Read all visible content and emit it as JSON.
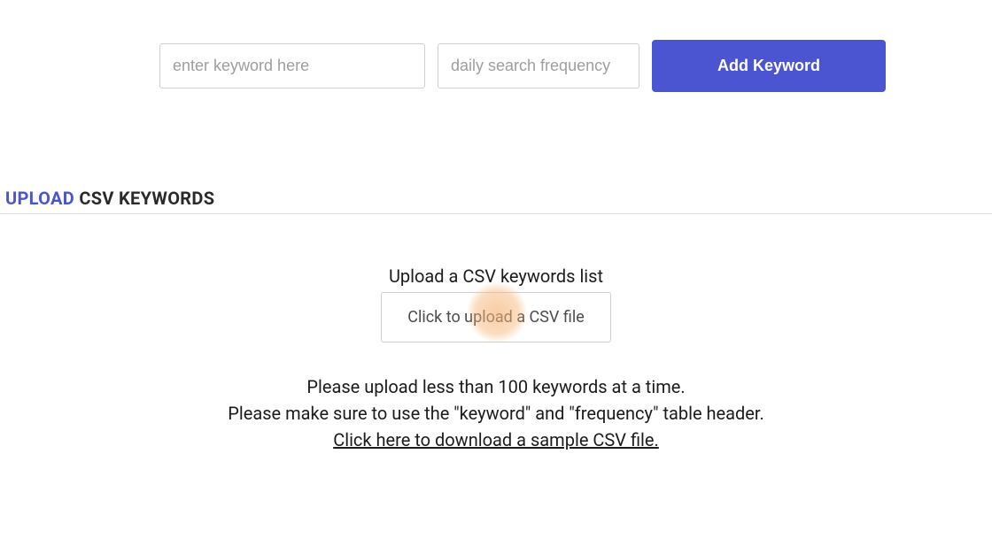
{
  "form": {
    "keyword_placeholder": "enter keyword here",
    "frequency_placeholder": "daily search frequency",
    "add_button_label": "Add Keyword"
  },
  "section": {
    "upload_word": "UPLOAD",
    "rest_heading": " CSV KEYWORDS"
  },
  "upload": {
    "title": "Upload a CSV keywords list",
    "button_label": "Click to upload a CSV file"
  },
  "instructions": {
    "line1": "Please upload less than 100 keywords at a time.",
    "line2": "Please make sure to use the \"keyword\" and \"frequency\" table header.",
    "download_link": "Click here to download a sample CSV file."
  }
}
